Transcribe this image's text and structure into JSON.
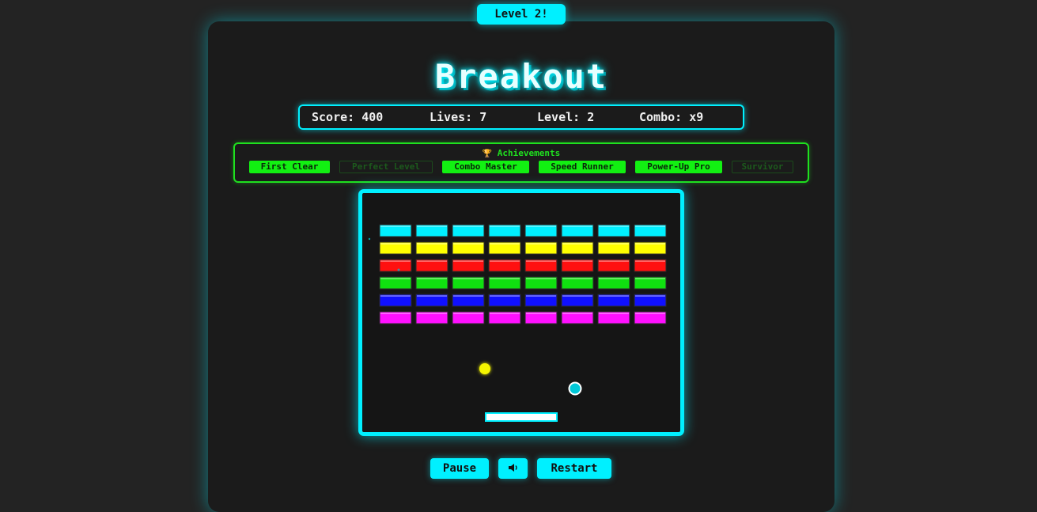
{
  "toast": {
    "text": "Level 2!"
  },
  "title": "Breakout",
  "stats": {
    "score": "Score: 400",
    "lives": "Lives: 7",
    "level": "Level: 2",
    "combo": "Combo: x9"
  },
  "achievements": {
    "title": "Achievements",
    "icon": "trophy-icon",
    "items": [
      {
        "label": "First Clear",
        "unlocked": true
      },
      {
        "label": "Perfect Level",
        "unlocked": false
      },
      {
        "label": "Combo Master",
        "unlocked": true
      },
      {
        "label": "Speed Runner",
        "unlocked": true
      },
      {
        "label": "Power-Up Pro",
        "unlocked": true
      },
      {
        "label": "Survivor",
        "unlocked": false
      }
    ]
  },
  "board": {
    "brick_rows": 6,
    "brick_columns": 8,
    "row_colors": [
      "#00f0ff",
      "#ffff00",
      "#ff1010",
      "#10e010",
      "#1010ff",
      "#ff10ff"
    ]
  },
  "controls": {
    "pause": "Pause",
    "sound_icon": "speaker-icon",
    "restart": "Restart"
  },
  "colors": {
    "accent": "#00f0ff",
    "achievement": "#1fe01f",
    "ball": "#f5f500",
    "powerup": "#00f0ff"
  }
}
